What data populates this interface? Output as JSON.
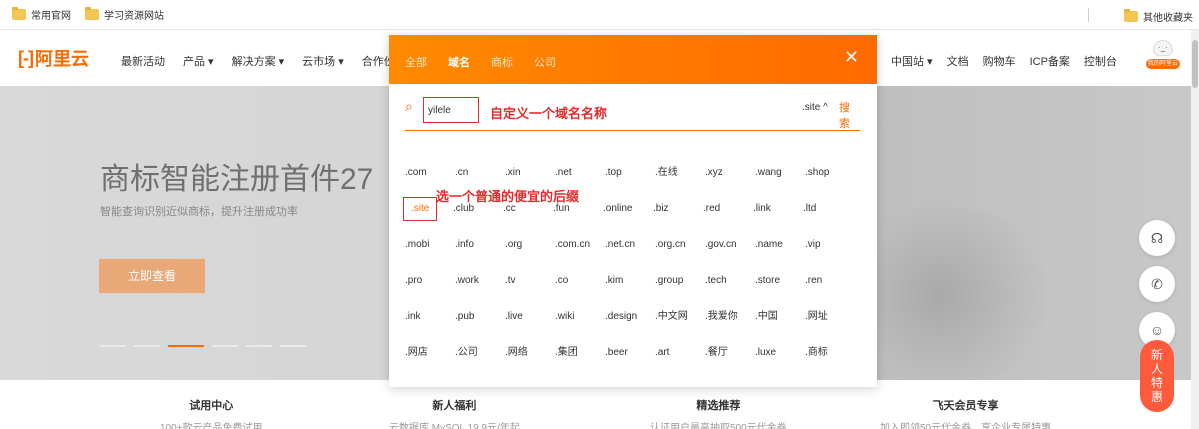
{
  "bookmarks": {
    "items": [
      {
        "label": "常用官网"
      },
      {
        "label": "学习资源网站"
      }
    ],
    "other": "其他收藏夹"
  },
  "header": {
    "logo_mark": "[-]",
    "logo_text": "阿里云",
    "nav": [
      "最新活动",
      "产品 ▾",
      "解决方案 ▾",
      "云市场 ▾",
      "合作伙伴"
    ],
    "right": [
      "中国站 ▾",
      "文档",
      "购物车",
      "ICP备案",
      "控制台"
    ],
    "avatar_tag": "我的阿里云"
  },
  "hero": {
    "title": "商标智能注册首件27",
    "subtitle": "智能查询识别近似商标，提升注册成功率",
    "button": "立即查看"
  },
  "bottom_cards": [
    {
      "title": "试用中心",
      "desc": "100+款云产品免费试用"
    },
    {
      "title": "新人福利",
      "desc": "云数据库 MySQL 19.9元/年起"
    },
    {
      "title": "精选推荐",
      "desc": "认证用户最高抽取500元代金券"
    },
    {
      "title": "飞天会员专享",
      "desc": "加入即领50元代金券，享企业专属特惠"
    }
  ],
  "tools": {
    "newbie": [
      "新",
      "人",
      "特",
      "惠"
    ]
  },
  "panel": {
    "tabs": [
      "全部",
      "域名",
      "商标",
      "公司"
    ],
    "active_tab": "域名",
    "close": "✕",
    "search_value": "yilele",
    "suffix_selected": ".site ^",
    "search_button": "搜索",
    "annotation_name": "自定义一个域名名称",
    "annotation_suffix": "选一个普通的便宜的后缀",
    "suffixes": [
      [
        ".com",
        ".cn",
        ".xin",
        ".net",
        ".top",
        ".在线",
        ".xyz",
        ".wang",
        ".shop"
      ],
      [
        ".site",
        ".club",
        ".cc",
        ".fun",
        ".online",
        ".biz",
        ".red",
        ".link",
        ".ltd"
      ],
      [
        ".mobi",
        ".info",
        ".org",
        ".com.cn",
        ".net.cn",
        ".org.cn",
        ".gov.cn",
        ".name",
        ".vip"
      ],
      [
        ".pro",
        ".work",
        ".tv",
        ".co",
        ".kim",
        ".group",
        ".tech",
        ".store",
        ".ren"
      ],
      [
        ".ink",
        ".pub",
        ".live",
        ".wiki",
        ".design",
        ".中文网",
        ".我爱你",
        ".中国",
        ".网址"
      ],
      [
        ".网店",
        ".公司",
        ".网络",
        ".集团",
        ".beer",
        ".art",
        ".餐厅",
        ".luxe",
        ".商标"
      ]
    ]
  },
  "colors": {
    "brand": "#ff6a00",
    "annotation": "#e52b2b"
  }
}
